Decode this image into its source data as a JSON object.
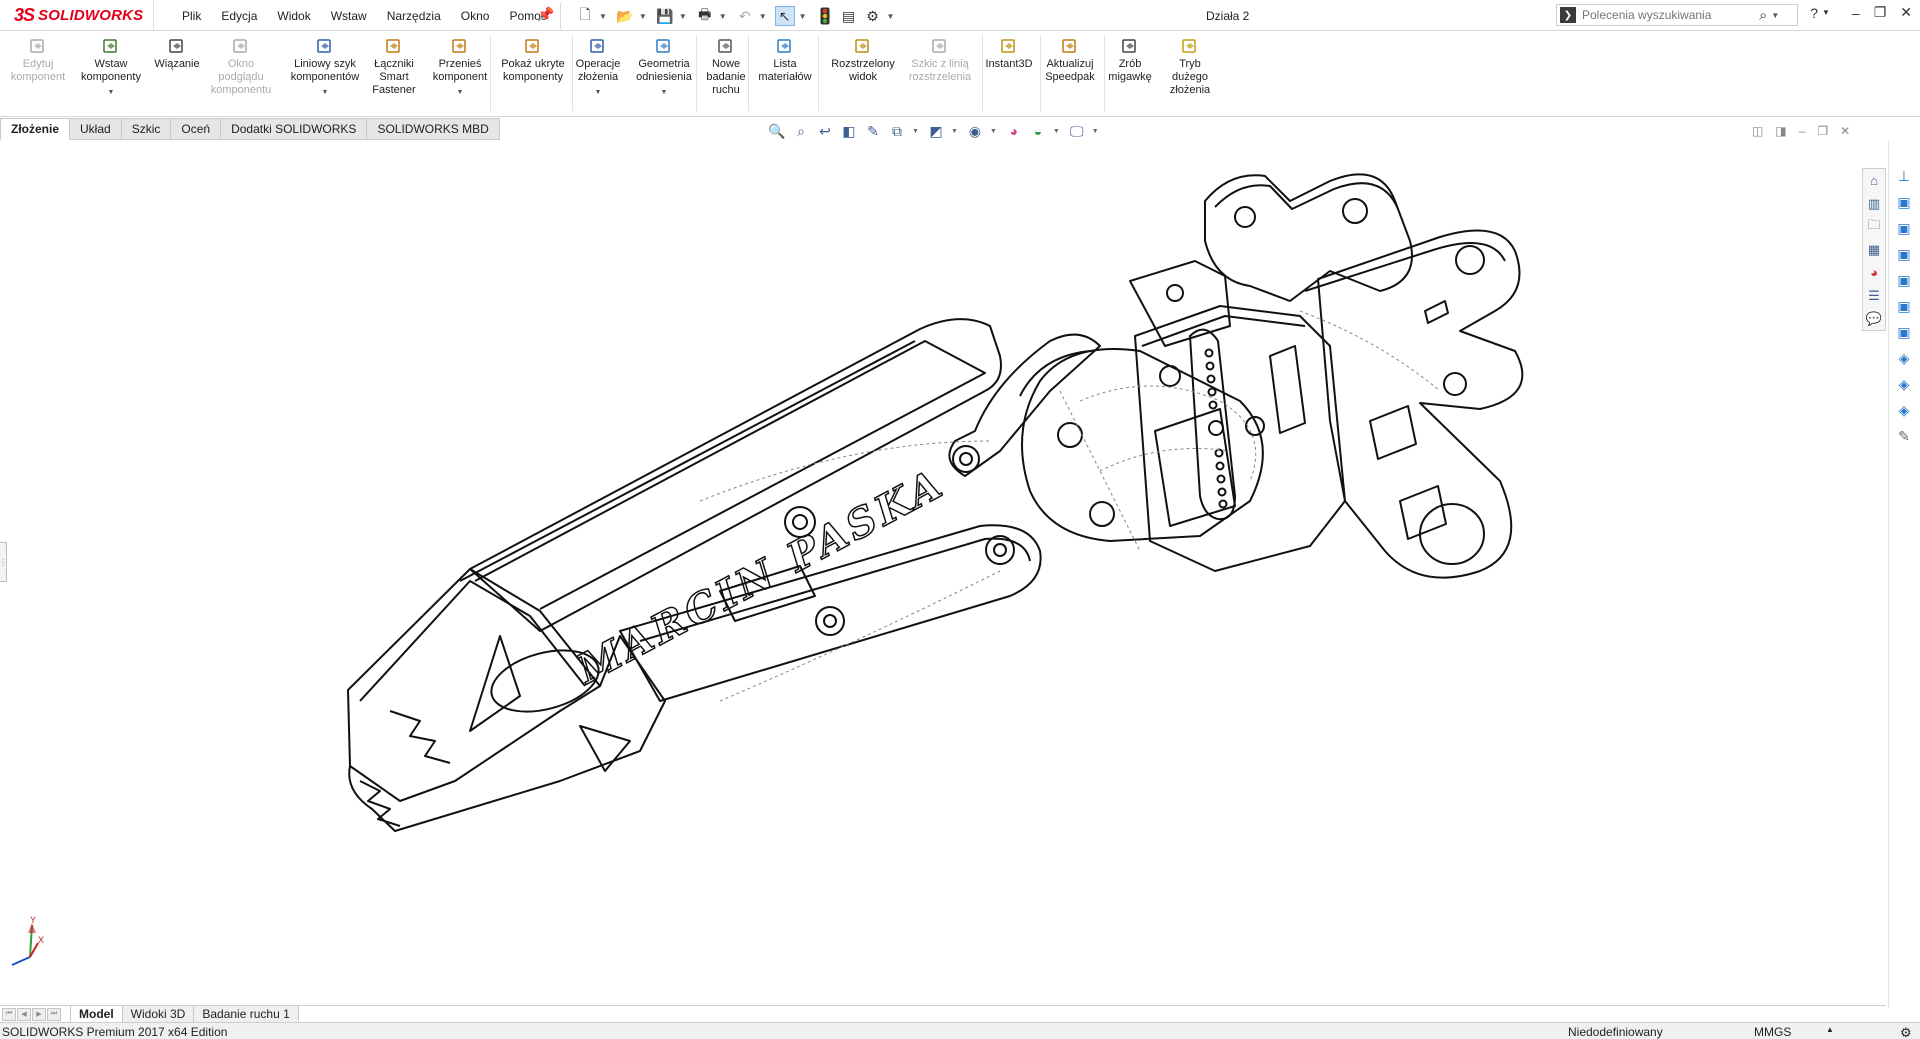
{
  "app": {
    "logo_prefix": "3S",
    "logo_name": "SOLIDWORKS",
    "document_title": "Działa 2"
  },
  "menu": [
    "Plik",
    "Edycja",
    "Widok",
    "Wstaw",
    "Narzędzia",
    "Okno",
    "Pomoc"
  ],
  "search": {
    "placeholder": "Polecenia wyszukiwania"
  },
  "ribbon": [
    {
      "label": [
        "Edytuj",
        "komponent"
      ],
      "icon": "edit-component-icon",
      "disabled": true
    },
    {
      "label": [
        "Wstaw",
        "komponenty"
      ],
      "icon": "insert-components-icon",
      "disabled": false,
      "dropdown": true
    },
    {
      "label": [
        "Wiązanie"
      ],
      "icon": "mate-icon",
      "disabled": false
    },
    {
      "label": [
        "Okno",
        "podglądu",
        "komponentu"
      ],
      "icon": "component-preview-icon",
      "disabled": true
    },
    {
      "label": [
        "Liniowy szyk",
        "komponentów"
      ],
      "icon": "linear-pattern-icon",
      "disabled": false,
      "dropdown": true
    },
    {
      "label": [
        "Łączniki",
        "Smart",
        "Fastener"
      ],
      "icon": "smart-fasteners-icon",
      "disabled": false
    },
    {
      "label": [
        "Przenieś",
        "komponent"
      ],
      "icon": "move-component-icon",
      "disabled": false,
      "dropdown": true
    },
    {
      "label": [
        "Pokaż ukryte",
        "komponenty"
      ],
      "icon": "show-hidden-icon",
      "disabled": false
    },
    {
      "label": [
        "Operacje",
        "złożenia"
      ],
      "icon": "assembly-features-icon",
      "disabled": false,
      "dropdown": true
    },
    {
      "label": [
        "Geometria",
        "odniesienia"
      ],
      "icon": "reference-geometry-icon",
      "disabled": false,
      "dropdown": true
    },
    {
      "label": [
        "Nowe",
        "badanie",
        "ruchu"
      ],
      "icon": "motion-study-icon",
      "disabled": false
    },
    {
      "label": [
        "Lista",
        "materiałów"
      ],
      "icon": "bill-of-materials-icon",
      "disabled": false
    },
    {
      "label": [
        "Rozstrzelony",
        "widok"
      ],
      "icon": "exploded-view-icon",
      "disabled": false
    },
    {
      "label": [
        "Szkic z linią",
        "rozstrzelenia"
      ],
      "icon": "explode-line-sketch-icon",
      "disabled": true
    },
    {
      "label": [
        "Instant3D"
      ],
      "icon": "instant3d-icon",
      "disabled": false
    },
    {
      "label": [
        "Aktualizuj",
        "Speedpak"
      ],
      "icon": "speedpak-icon",
      "disabled": false
    },
    {
      "label": [
        "Zrób",
        "migawkę"
      ],
      "icon": "snapshot-icon",
      "disabled": false
    },
    {
      "label": [
        "Tryb",
        "dużego",
        "złożenia"
      ],
      "icon": "large-assembly-icon",
      "disabled": false
    }
  ],
  "tabs": [
    "Złożenie",
    "Układ",
    "Szkic",
    "Oceń",
    "Dodatki SOLIDWORKS",
    "SOLIDWORKS MBD"
  ],
  "active_tab": "Złożenie",
  "model": {
    "engraving": "MARCIN PASKA"
  },
  "triad": {
    "y": "Y",
    "x": "X"
  },
  "bottom_tabs": [
    "Model",
    "Widoki 3D",
    "Badanie ruchu 1"
  ],
  "active_bottom_tab": "Model",
  "status": {
    "edition": "SOLIDWORKS Premium 2017 x64 Edition",
    "state": "Niedodefiniowany",
    "units": "MMGS"
  },
  "colors": {
    "brand": "#e2001a",
    "accent": "#2a78c9"
  }
}
